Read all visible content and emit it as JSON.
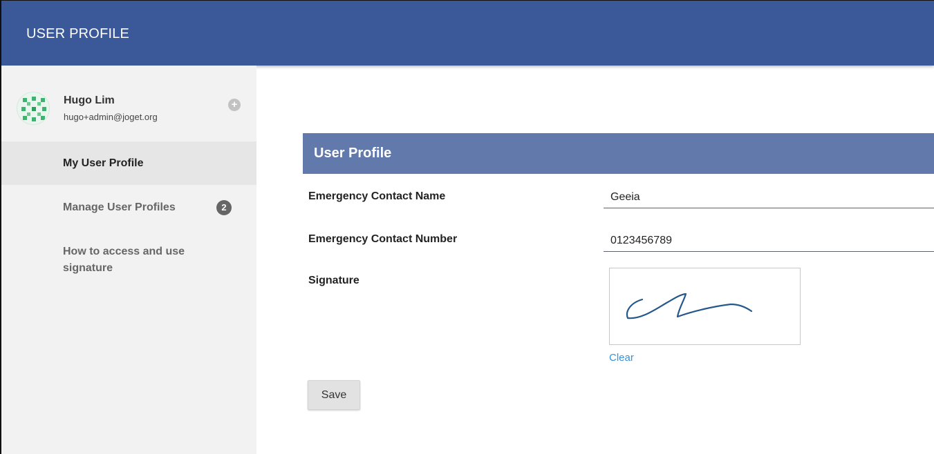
{
  "header": {
    "title": "USER PROFILE",
    "bg_color": "#3b5998"
  },
  "user": {
    "name": "Hugo Lim",
    "email": "hugo+admin@joget.org",
    "avatar_icon": "identicon-avatar",
    "add_icon": "plus-circle-icon"
  },
  "sidebar": {
    "items": [
      {
        "label": "My User Profile",
        "active": true
      },
      {
        "label": "Manage User Profiles",
        "badge": "2"
      },
      {
        "label": "How to access and use signature"
      }
    ]
  },
  "form": {
    "title": "User Profile",
    "header_color": "#6279ab",
    "fields": [
      {
        "label": "Emergency Contact Name",
        "value": "Geeia"
      },
      {
        "label": "Emergency Contact Number",
        "value": "0123456789"
      },
      {
        "label": "Signature"
      }
    ],
    "clear_label": "Clear",
    "save_label": "Save",
    "link_color": "#3a8fd8"
  }
}
